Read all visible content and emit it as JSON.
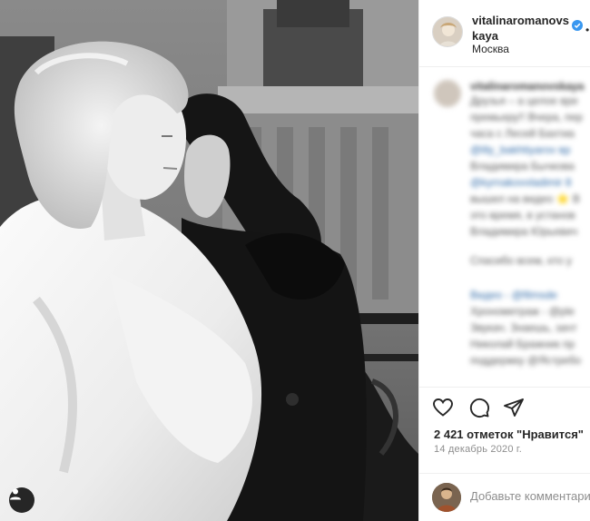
{
  "post": {
    "username": "vitalinaromanovskaya",
    "location": "Москва",
    "likes": "2 421 отметок \"Нравится\"",
    "date": "14 декабрь 2020 г.",
    "comment_placeholder": "Добавьте комментарий..."
  },
  "caption_lines": [
    "vitalinaromanovskaya",
    "Друзья – а целое вре",
    "премьеру!! Вчера, пер",
    "часа с Лесей Бахтиа",
    "@lily_bakhtiyarov вр",
    "Владимира Бычкова",
    "@kyrnakovvladimir 8",
    "вышел на видео ⭐ В",
    "это время, в установ",
    "Владимира Юрьевич",
    "Спасибо всем, кто у",
    "Видео - @filmsde",
    "Хронометраж - @ple",
    "Звукач. Знаешь, зачт",
    "Николай Бражник пр",
    "поддержку @Ястребо"
  ],
  "icons": {
    "like": "heart-icon",
    "comment": "comment-icon",
    "share": "paper-plane-icon",
    "verified": "verified-badge-icon",
    "tagged_users": "user-tag-icon"
  },
  "colors": {
    "verified": "#3897f0",
    "text": "#262626",
    "muted": "#8e8e8e"
  }
}
